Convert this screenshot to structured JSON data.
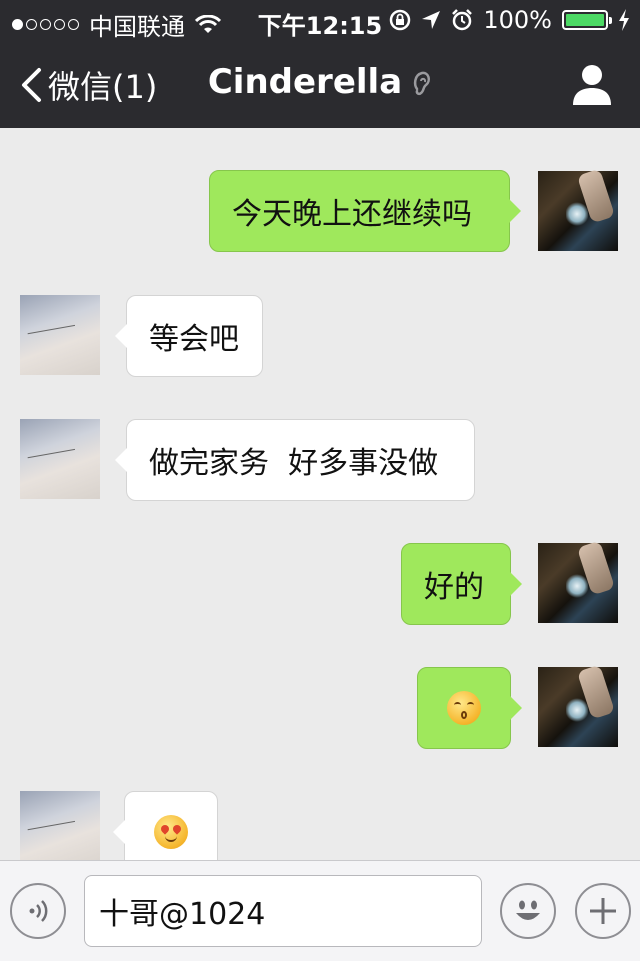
{
  "status_bar": {
    "carrier": "中国联通",
    "time": "下午12:15",
    "battery": "100%",
    "battery_level": 1.0,
    "icons": [
      "signal-dots-icon",
      "wifi-icon",
      "rotation-lock-icon",
      "location-icon",
      "alarm-icon",
      "battery-icon",
      "charging-icon"
    ]
  },
  "nav": {
    "back_label": "微信(1)",
    "title": "Cinderella",
    "icons": [
      "chevron-left-icon",
      "ear-icon",
      "contact-person-icon"
    ]
  },
  "messages": [
    {
      "side": "out",
      "type": "text",
      "text": "今天晚上还继续吗"
    },
    {
      "side": "in",
      "type": "text",
      "text": "等会吧"
    },
    {
      "side": "in",
      "type": "text",
      "text": "做完家务  好多事没做"
    },
    {
      "side": "out",
      "type": "text",
      "text": "好的"
    },
    {
      "side": "out",
      "type": "emoji",
      "emoji": "kissing-face-emoji"
    },
    {
      "side": "in",
      "type": "emoji",
      "emoji": "heart-eyes-emoji"
    }
  ],
  "input": {
    "value": "十哥@1024",
    "icons": [
      "voice-icon",
      "emoji-smile-icon",
      "plus-icon"
    ]
  },
  "colors": {
    "bar_bg": "#2b2b2f",
    "chat_bg": "#ebebeb",
    "outgoing_bubble": "#9fe85c",
    "incoming_bubble": "#ffffff",
    "battery_green": "#4cd964"
  }
}
